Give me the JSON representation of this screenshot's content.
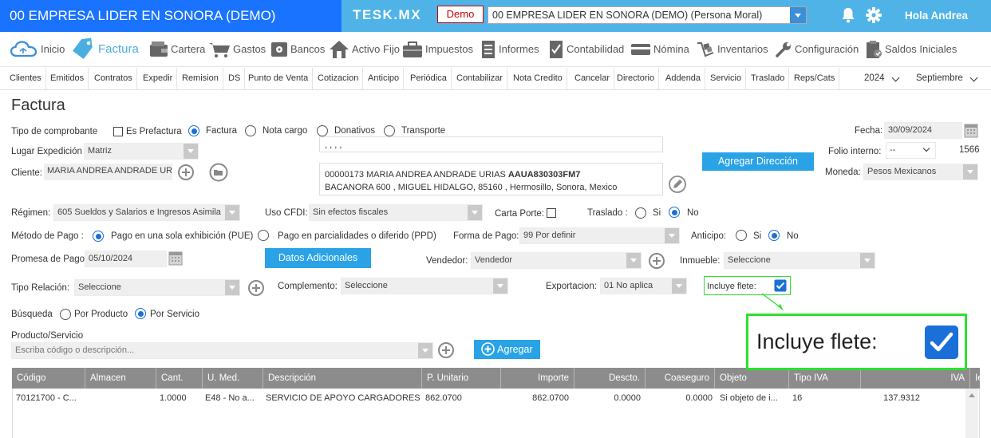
{
  "app": {
    "company_title": "00 EMPRESA LIDER EN SONORA (DEMO)",
    "brand": "TESK.MX",
    "demo_badge": "Demo",
    "company_select": "00 EMPRESA LIDER EN SONORA (DEMO) (Persona Moral)",
    "greeting": "Hola Andrea"
  },
  "main_menu": [
    {
      "label": "Inicio",
      "icon": "cloud-icon"
    },
    {
      "label": "Factura",
      "icon": "tag-icon",
      "active": true
    },
    {
      "label": "Cartera",
      "icon": "wallet-icon"
    },
    {
      "label": "Gastos",
      "icon": "cart-icon"
    },
    {
      "label": "Bancos",
      "icon": "safe-icon"
    },
    {
      "label": "Activo Fijo",
      "icon": "house-icon"
    },
    {
      "label": "Impuestos",
      "icon": "briefcase-icon"
    },
    {
      "label": "Informes",
      "icon": "document-icon"
    },
    {
      "label": "Contabilidad",
      "icon": "checklist-icon"
    },
    {
      "label": "Nómina",
      "icon": "card-icon"
    },
    {
      "label": "Inventarios",
      "icon": "boxes-icon"
    },
    {
      "label": "Configuración",
      "icon": "wrench-icon"
    },
    {
      "label": "Saldos Iniciales",
      "icon": "clipboard-icon"
    }
  ],
  "sub_menu": [
    "Clientes",
    "Emitidos",
    "Contratos",
    "Expedir",
    "Remision",
    "DS",
    "Punto de Venta",
    "Cotizacion",
    "Anticipo",
    "Periódica",
    "Contabilizar",
    "Nota Credito",
    "Cancelar",
    "Directorio",
    "Addenda",
    "Servicio",
    "Traslado",
    "Reps/Cats"
  ],
  "year_select": "2024",
  "month_select": "Septiembre",
  "page_title": "Factura",
  "form": {
    "tipo_comprobante_label": "Tipo de comprobante",
    "es_prefactura": "Es Prefactura",
    "tipo_options": [
      "Factura",
      "Nota cargo",
      "Donativos",
      "Transporte"
    ],
    "fecha_label": "Fecha:",
    "fecha_value": "30/09/2024",
    "lugar_label": "Lugar Expedición",
    "lugar_value": "Matriz",
    "address_line_top": ", , , ,",
    "folio_label": "Folio interno:",
    "folio_select": "--",
    "folio_value": "1566",
    "cliente_label": "Cliente:",
    "cliente_value": "MARIA ANDREA ANDRADE URI",
    "cliente_info_line1": "00000173 MARIA ANDREA ANDRADE URIAS",
    "cliente_rfc": "AAUA830303FM7",
    "cliente_info_line2": "BACANORA 600 , MIGUEL HIDALGO, 85160 , Hermosillo, Sonora, Mexico",
    "agregar_direccion": "Agregar Dirección",
    "moneda_label": "Moneda:",
    "moneda_value": "Pesos Mexicanos",
    "regimen_label": "Régimen:",
    "regimen_value": "605 Sueldos y Salarios e Ingresos Asimila",
    "uso_cfdi_label": "Uso CFDI:",
    "uso_cfdi_value": "Sin efectos fiscales",
    "carta_porte_label": "Carta Porte:",
    "traslado_label": "Traslado :",
    "si": "Si",
    "no": "No",
    "metodo_label": "Método de Pago :",
    "metodo_pue": "Pago en una sola exhibición (PUE)",
    "metodo_ppd": "Pago en parcialidades o diferido (PPD)",
    "forma_label": "Forma de Pago:",
    "forma_value": "99  Por definir",
    "anticipo_label": "Anticipo:",
    "promesa_label": "Promesa de Pago",
    "promesa_value": "05/10/2024",
    "datos_adicionales": "Datos Adicionales",
    "vendedor_label": "Vendedor:",
    "vendedor_value": "Vendedor",
    "inmueble_label": "Inmueble:",
    "inmueble_value": "Seleccione",
    "tipo_relacion_label": "Tipo Relación:",
    "tipo_relacion_value": "Seleccione",
    "complemento_label": "Complemento:",
    "complemento_value": "Seleccione",
    "exportacion_label": "Exportacion:",
    "exportacion_value": "01 No aplica",
    "incluye_flete_label": "Incluye flete:",
    "busqueda_label": "Búsqueda",
    "por_producto": "Por Producto",
    "por_servicio": "Por Servicio",
    "producto_label": "Producto/Servicio",
    "producto_placeholder": "Escriba código o descripción...",
    "agregar": "Agregar"
  },
  "table": {
    "headers": [
      "Código",
      "Almacen",
      "Cant.",
      "U. Med.",
      "Descripción",
      "P. Unitario",
      "Importe",
      "Descto.",
      "Coaseguro",
      "Objeto",
      "Tipo IVA",
      "IVA",
      "Ie"
    ],
    "rows": [
      [
        "70121700 - C...",
        "",
        "1.0000",
        "E48 - No a...",
        "SERVICIO DE APOYO CARGADORES",
        "862.0700",
        "862.0700",
        "0.0000",
        "0.0000",
        "Si objeto de i...",
        "16",
        "137.9312"
      ]
    ]
  },
  "zoom_callout": {
    "label": "Incluye flete:"
  },
  "colors": {
    "top_left": "#1a73ff",
    "top_right": "#4fb3e8",
    "button": "#2aa2e6",
    "highlight": "#2ee02e",
    "checkbox": "#1a6fd8"
  }
}
